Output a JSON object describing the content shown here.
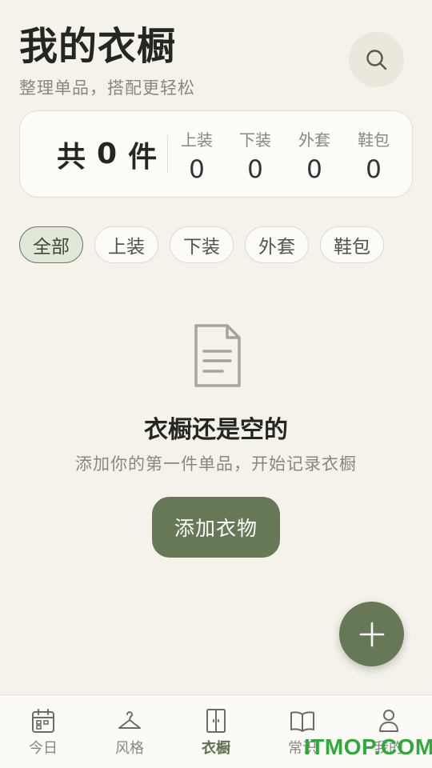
{
  "header": {
    "title": "我的衣橱",
    "subtitle": "整理单品，搭配更轻松"
  },
  "summary": {
    "total_prefix": "共",
    "total_count": "0",
    "total_suffix": "件",
    "stats": [
      {
        "label": "上装",
        "value": "0"
      },
      {
        "label": "下装",
        "value": "0"
      },
      {
        "label": "外套",
        "value": "0"
      },
      {
        "label": "鞋包",
        "value": "0"
      }
    ]
  },
  "filters": [
    "全部",
    "上装",
    "下装",
    "外套",
    "鞋包"
  ],
  "active_filter": "全部",
  "empty": {
    "title": "衣橱还是空的",
    "subtitle": "添加你的第一件单品，开始记录衣橱",
    "button": "添加衣物"
  },
  "tabs": [
    {
      "label": "今日",
      "icon": "calendar-icon"
    },
    {
      "label": "风格",
      "icon": "hanger-icon"
    },
    {
      "label": "衣橱",
      "icon": "wardrobe-icon"
    },
    {
      "label": "常识",
      "icon": "book-icon"
    },
    {
      "label": "我的",
      "icon": "person-icon"
    }
  ],
  "active_tab": "衣橱",
  "watermark": "ITMOP.COM",
  "colors": {
    "background": "#f5f2eb",
    "accent": "#667856",
    "chip_active_bg": "#e1e8da"
  }
}
